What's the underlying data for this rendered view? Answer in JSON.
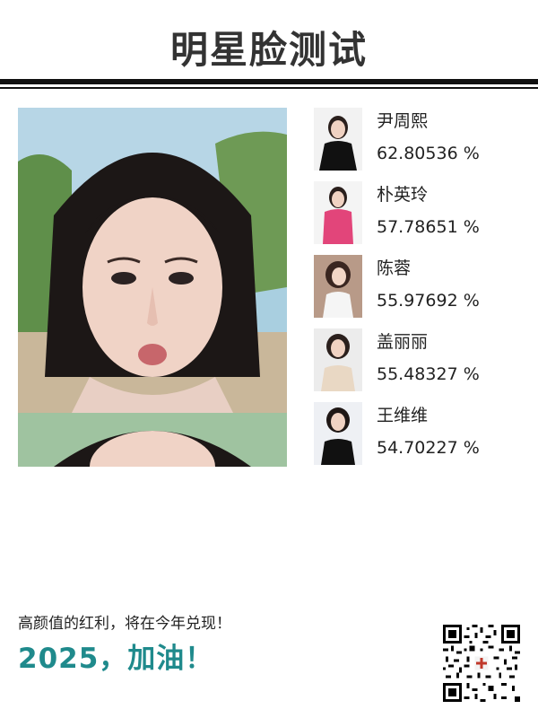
{
  "header": {
    "title": "明星脸测试"
  },
  "results": [
    {
      "name": "尹周熙",
      "score": "62.80536 %"
    },
    {
      "name": "朴英玲",
      "score": "57.78651 %"
    },
    {
      "name": "陈蓉",
      "score": "55.97692 %"
    },
    {
      "name": "盖丽丽",
      "score": "55.48327 %"
    },
    {
      "name": "王维维",
      "score": "54.70227 %"
    }
  ],
  "footer": {
    "slogan": "高颜值的红利，将在今年兑现！",
    "cheer": "2025，加油！"
  },
  "colors": {
    "accent": "#1f8a8c",
    "rule": "#111111"
  }
}
